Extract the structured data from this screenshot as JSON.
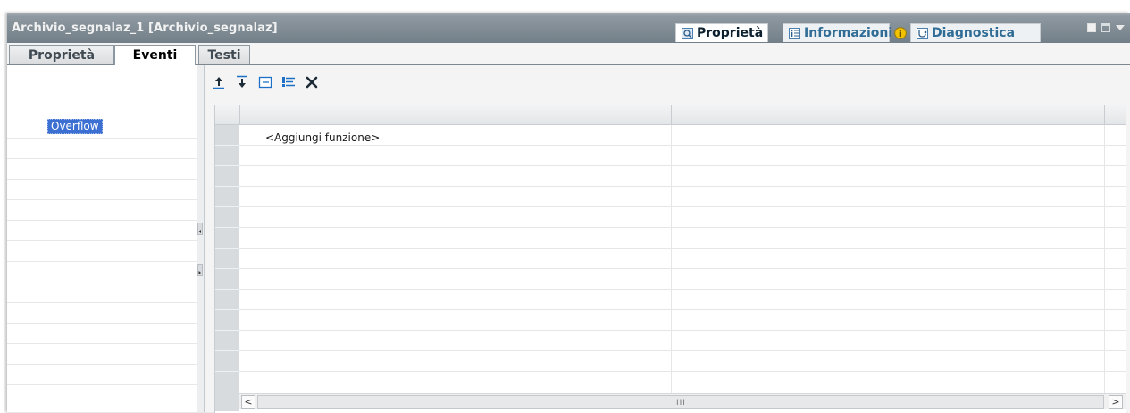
{
  "window": {
    "title": "Archivio_segnalaz_1 [Archivio_segnalaz]"
  },
  "inspector_tabs": [
    {
      "label": "Proprietà",
      "icon": "properties-icon",
      "active": true
    },
    {
      "label": "Informazioni",
      "icon": "info-icon",
      "active": false
    },
    {
      "label": "Diagnostica",
      "icon": "diagnostics-icon",
      "active": false
    }
  ],
  "sub_tabs": [
    {
      "label": "Proprietà",
      "active": false
    },
    {
      "label": "Eventi",
      "active": true
    },
    {
      "label": "Testi",
      "active": false
    }
  ],
  "event_list": {
    "items": [
      {
        "label": "Overflow",
        "selected": true
      }
    ]
  },
  "toolbar": {
    "buttons": [
      "move-up-icon",
      "move-down-icon",
      "collapse-icon",
      "expand-icon",
      "delete-icon"
    ]
  },
  "function_list": {
    "add_row_label": "<Aggiungi funzione>"
  },
  "scrollbar": {
    "grip": "III",
    "left_arrow": "<",
    "right_arrow": ">"
  },
  "colors": {
    "titlebar": "#7f8b94",
    "selection": "#3b6fd1",
    "info_badge": "#f2c200",
    "accent_blue": "#2f6c96"
  }
}
